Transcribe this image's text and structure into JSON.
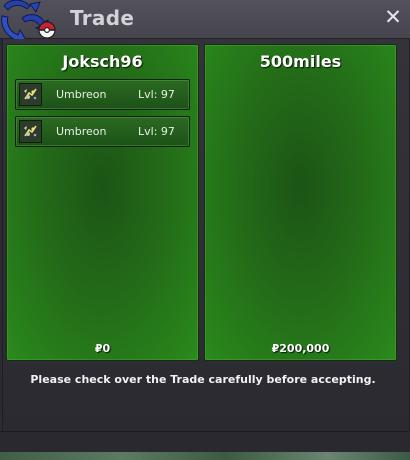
{
  "window": {
    "title": "Trade",
    "close_glyph": "✕"
  },
  "left_panel": {
    "player": "Joksch96",
    "items": [
      {
        "name": "Umbreon",
        "level": "Lvl: 97",
        "icon": "umbreon-sprite-icon"
      },
      {
        "name": "Umbreon",
        "level": "Lvl: 97",
        "icon": "umbreon-sprite-icon"
      }
    ],
    "money": "₽0"
  },
  "right_panel": {
    "player": "500miles",
    "items": [],
    "money": "₽200,000"
  },
  "notice": "Please check over the Trade carefully before accepting.",
  "colors": {
    "panel_green": "#236a18",
    "titlebar": "#4c4b55",
    "logo_blue": "#2740a8",
    "logo_red": "#d02030"
  }
}
